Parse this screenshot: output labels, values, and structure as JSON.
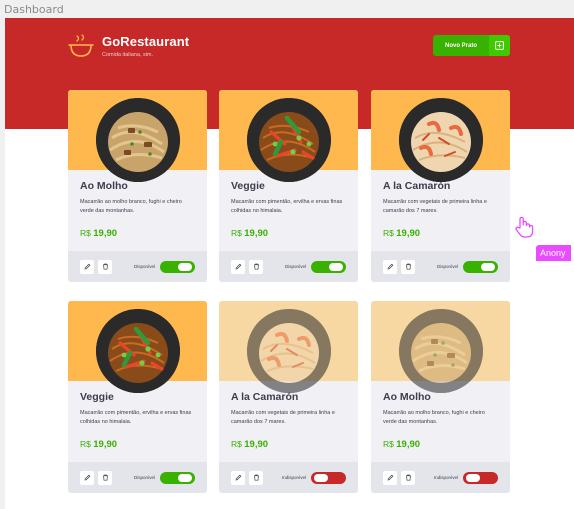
{
  "frame": {
    "label": "Dashboard"
  },
  "header": {
    "brand_title": "GoRestaurant",
    "brand_subtitle": "Comida italiana, sim.",
    "new_button_label": "Novo Prato"
  },
  "cards": [
    {
      "name": "Ao Molho",
      "description": "Macarrão ao molho branco, fughi e cheiro verde das montanhas.",
      "currency": "R$",
      "price": "19,90",
      "status": "Disponível",
      "available": true,
      "dish": "alfredo"
    },
    {
      "name": "Veggie",
      "description": "Macarrão com pimentão, ervilha e ervas finas colhidas no himalaia.",
      "currency": "R$",
      "price": "19,90",
      "status": "Disponível",
      "available": true,
      "dish": "veggie"
    },
    {
      "name": "A la Camarón",
      "description": "Macarrão com vegetais de primeira linha e camarão dos 7 mares.",
      "currency": "R$",
      "price": "19,90",
      "status": "Disponível",
      "available": true,
      "dish": "shrimp"
    },
    {
      "name": "Veggie",
      "description": "Macarrão com pimentão, ervilha e ervas finas colhidas no himalaia.",
      "currency": "R$",
      "price": "19,90",
      "status": "Disponível",
      "available": true,
      "dish": "veggie"
    },
    {
      "name": "A la Camarón",
      "description": "Macarrão com vegetais de primeira linha e camarão dos 7 mares.",
      "currency": "R$",
      "price": "19,90",
      "status": "Indisponível",
      "available": false,
      "dish": "shrimp"
    },
    {
      "name": "Ao Molho",
      "description": "Macarrão ao molho branco, fughi e cheiro verde das montanhas.",
      "currency": "R$",
      "price": "19,90",
      "status": "Indisponível",
      "available": false,
      "dish": "alfredo"
    }
  ],
  "presence": {
    "label": "Anony"
  },
  "colors": {
    "header": "#c72828",
    "accent_green": "#39b100",
    "card_top": "#ffb84d",
    "unavailable_red": "#c72828",
    "cursor_pink": "#e94bff"
  }
}
